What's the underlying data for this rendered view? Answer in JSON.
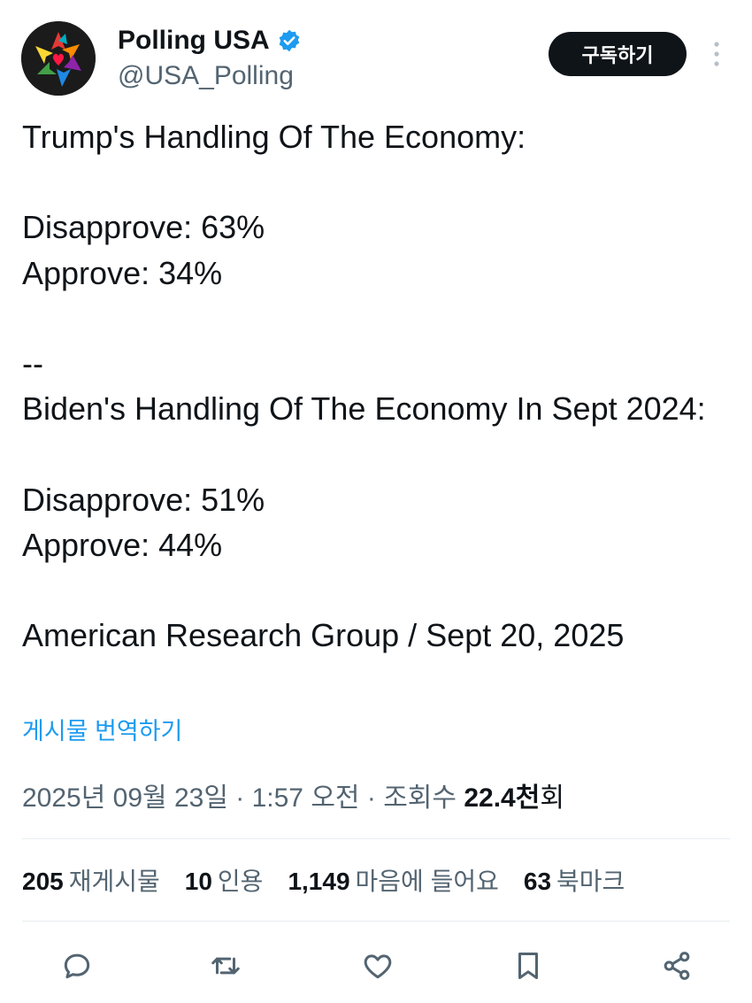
{
  "account": {
    "display_name": "Polling USA",
    "handle": "@USA_Polling",
    "verified": true,
    "avatar_icon": "colorful-star-logo",
    "subscribe_label": "구독하기"
  },
  "tweet": {
    "text": "Trump's Handling Of The Economy:\n\nDisapprove: 63%\nApprove: 34%\n\n--\nBiden's Handling Of The Economy In Sept 2024:\n\nDisapprove: 51%\nApprove: 44%\n\nAmerican Research Group / Sept 20, 2025",
    "translate_label": "게시물 번역하기",
    "timestamp": "2025년 09월 23일 · 1:57 오전 · 조회수 ",
    "views_number": "22.4",
    "views_unit": "천",
    "views_suffix": "회"
  },
  "stats": {
    "reposts_count": "205",
    "reposts_label": "재게시물",
    "quotes_count": "10",
    "quotes_label": "인용",
    "likes_count": "1,149",
    "likes_label": "마음에 들어요",
    "bookmarks_count": "63",
    "bookmarks_label": "북마크"
  },
  "actions": [
    "reply-icon",
    "retweet-icon",
    "heart-icon",
    "bookmark-icon",
    "share-icon"
  ],
  "colors": {
    "text": "#0f1419",
    "secondary": "#536471",
    "link": "#1d9bf0",
    "verified": "#1d9bf0",
    "button_bg": "#0f1419"
  }
}
